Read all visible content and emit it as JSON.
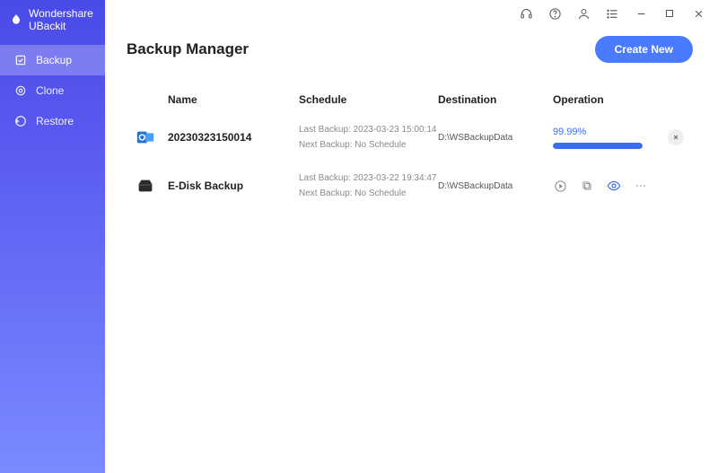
{
  "app": {
    "title": "Wondershare UBackit"
  },
  "sidebar": {
    "items": [
      {
        "label": "Backup"
      },
      {
        "label": "Clone"
      },
      {
        "label": "Restore"
      }
    ]
  },
  "header": {
    "title": "Backup Manager",
    "create_label": "Create New"
  },
  "columns": {
    "name": "Name",
    "schedule": "Schedule",
    "destination": "Destination",
    "operation": "Operation"
  },
  "rows": [
    {
      "name": "20230323150014",
      "last": "Last Backup: 2023-03-23 15:00:14",
      "next": "Next Backup: No Schedule",
      "dest": "D:\\WSBackupData",
      "progress_label": "99.99%"
    },
    {
      "name": "E-Disk Backup",
      "last": "Last Backup: 2023-03-22 19:34:47",
      "next": "Next Backup: No Schedule",
      "dest": "D:\\WSBackupData"
    }
  ]
}
